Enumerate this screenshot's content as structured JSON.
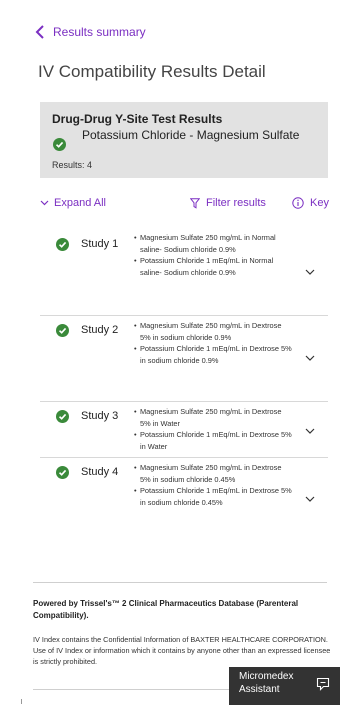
{
  "nav": {
    "back_label": "Results summary"
  },
  "page": {
    "title": "IV Compatibility Results Detail"
  },
  "summary": {
    "header": "Drug-Drug Y-Site Test Results",
    "pair": "Potassium Chloride - Magnesium Sulfate",
    "count": "Results: 4"
  },
  "toolbar": {
    "expand_label": "Expand All",
    "filter_label": "Filter results",
    "key_label": "Key"
  },
  "studies": [
    {
      "name": "Study 1",
      "lines": [
        "Magnesium Sulfate 250 mg/mL in Normal saline- Sodium chloride 0.9%",
        "Potassium Chloride 1 mEq/mL in Normal saline- Sodium chloride 0.9%"
      ]
    },
    {
      "name": "Study 2",
      "lines": [
        "Magnesium Sulfate 250 mg/mL in Dextrose 5% in sodium chloride 0.9%",
        "Potassium Chloride 1 mEq/mL in Dextrose 5% in sodium chloride 0.9%"
      ]
    },
    {
      "name": "Study 3",
      "lines": [
        "Magnesium Sulfate 250 mg/mL in Dextrose 5% in Water",
        "Potassium Chloride 1 mEq/mL in Dextrose 5% in Water"
      ]
    },
    {
      "name": "Study 4",
      "lines": [
        "Magnesium Sulfate 250 mg/mL in Dextrose 5% in sodium chloride 0.45%",
        "Potassium Chloride 1 mEq/mL in Dextrose 5% in sodium chloride 0.45%"
      ]
    }
  ],
  "footer": {
    "powered": "Powered by Trissel's™ 2 Clinical Pharmaceutics Database (Parenteral Compatibility).",
    "legal": "IV Index contains the Confidential Information of BAXTER HEALTHCARE CORPORATION. Use of IV Index or information which it contains by anyone other than an expressed licensee is strictly prohibited."
  },
  "assistant": {
    "line1": "Micromedex",
    "line2": "Assistant"
  },
  "colors": {
    "accent": "#7b2fc2",
    "check_green": "#3a8a3a",
    "summary_bg": "#e2e2e2",
    "assistant_bg": "#333333"
  }
}
